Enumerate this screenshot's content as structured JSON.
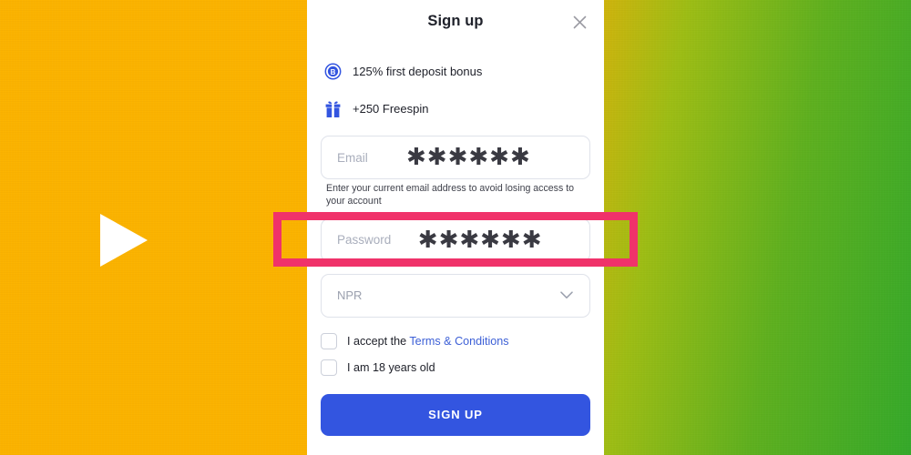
{
  "background": {
    "left_color": "#fbb300",
    "gradient_start": "#cfb40d",
    "gradient_end": "#35a92a",
    "play_icon_name": "play-icon"
  },
  "annotation": {
    "color": "#f0326a",
    "target": "password-field"
  },
  "modal": {
    "title": "Sign up",
    "close_icon": "close-icon",
    "bonuses": [
      {
        "icon": "bonus-badge-icon",
        "text": "125% first deposit bonus"
      },
      {
        "icon": "gift-icon",
        "text": "+250 Freespin"
      }
    ],
    "email_field": {
      "placeholder": "Email",
      "masked_value": "✱✱✱✱✱✱",
      "hint": "Enter your current email address to avoid losing access to your account"
    },
    "password_field": {
      "placeholder": "Password",
      "masked_value": "✱✱✱✱✱✱"
    },
    "currency_select": {
      "value": "NPR",
      "chevron_icon": "chevron-down-icon"
    },
    "checkboxes": [
      {
        "prefix": "I accept the ",
        "link": "Terms & Conditions",
        "checked": false
      },
      {
        "prefix": "I am 18 years old",
        "link": "",
        "checked": false
      }
    ],
    "submit_label": "SIGN UP",
    "submit_color": "#3355e0"
  }
}
